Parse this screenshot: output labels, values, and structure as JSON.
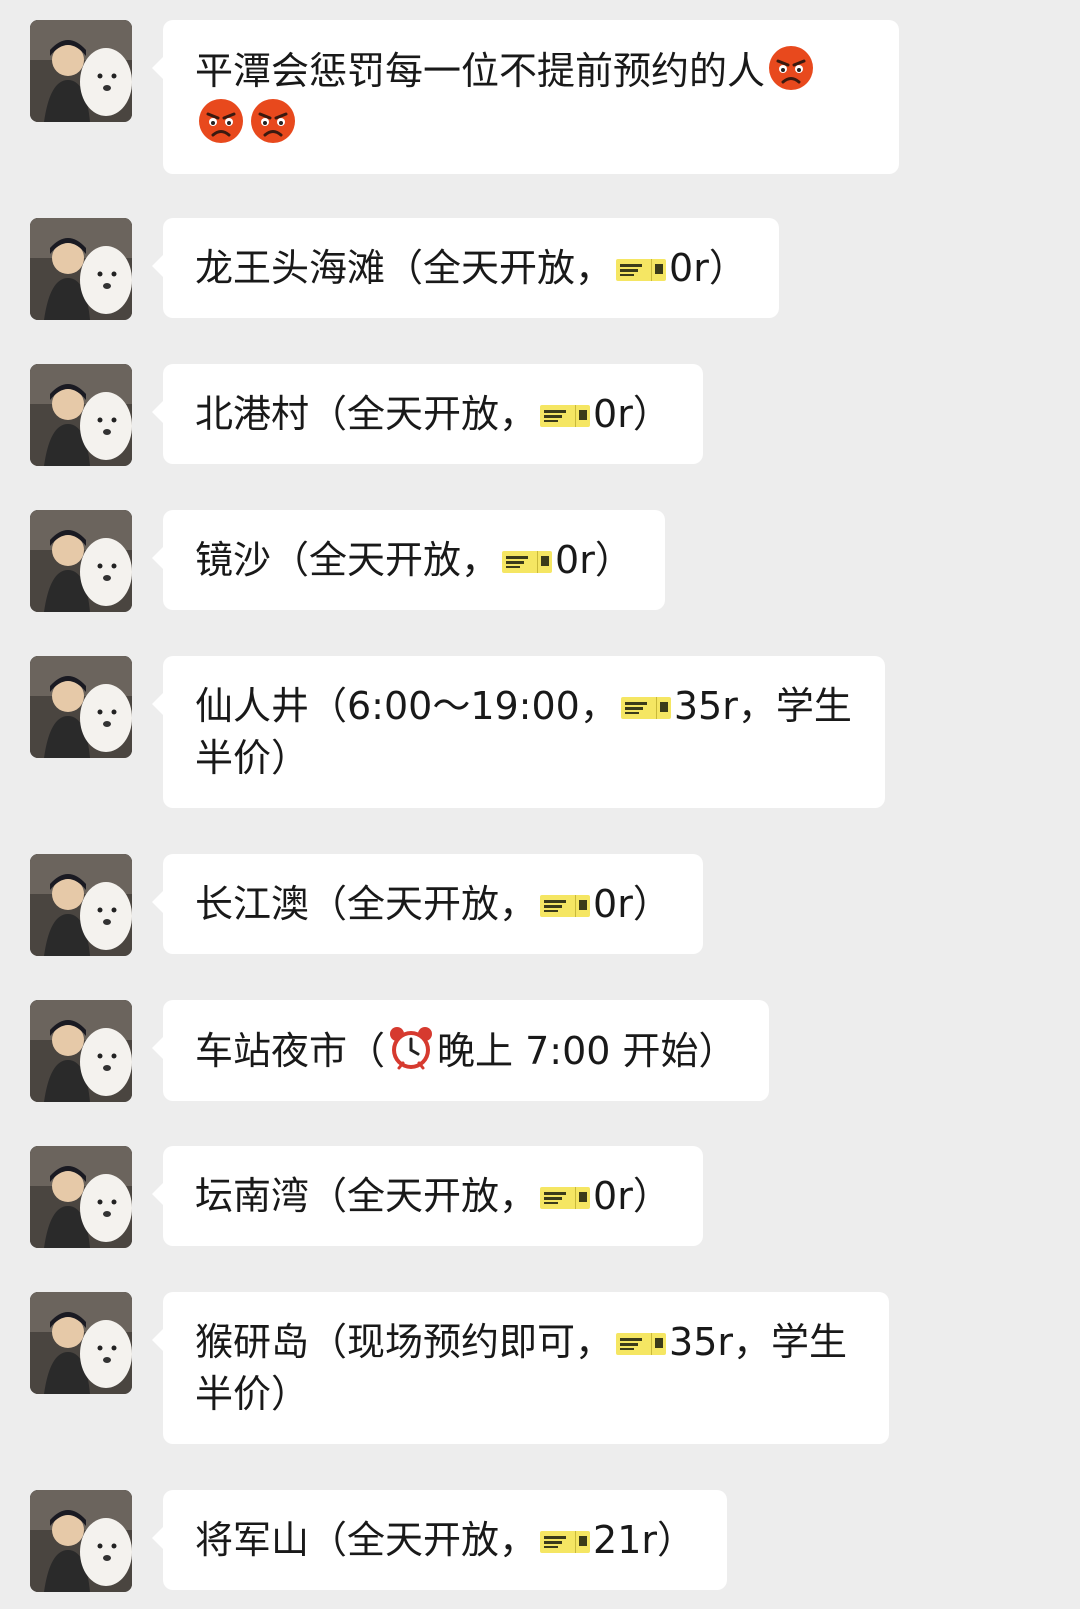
{
  "messages": [
    {
      "parts": [
        "平潭会惩罚每一位不提前预约的人",
        "",
        "",
        ""
      ]
    },
    {
      "parts": [
        "龙王头海滩（全天开放，",
        "0r）"
      ]
    },
    {
      "parts": [
        "北港村（全天开放，",
        "0r）"
      ]
    },
    {
      "parts": [
        "镜沙（全天开放，",
        "0r）"
      ]
    },
    {
      "parts": [
        "仙人井（6:00～19:00，",
        "35r，学生半价）"
      ]
    },
    {
      "parts": [
        "长江澳（全天开放，",
        "0r）"
      ]
    },
    {
      "parts": [
        "车站夜市（",
        "晚上 7:00 开始）"
      ]
    },
    {
      "parts": [
        "坛南湾（全天开放，",
        "0r）"
      ]
    },
    {
      "parts": [
        "猴研岛（现场预约即可，",
        "35r，学生半价）"
      ]
    },
    {
      "parts": [
        "将军山（全天开放，",
        "21r）"
      ]
    }
  ],
  "icons": {
    "angry": "angry-face-icon",
    "ticket": "ticket-icon",
    "clock": "alarm-clock-icon"
  },
  "colors": {
    "background": "#ededed",
    "bubble": "#ffffff",
    "text": "#191919",
    "ticket": "#f5e663",
    "angry": "#e8491d"
  }
}
